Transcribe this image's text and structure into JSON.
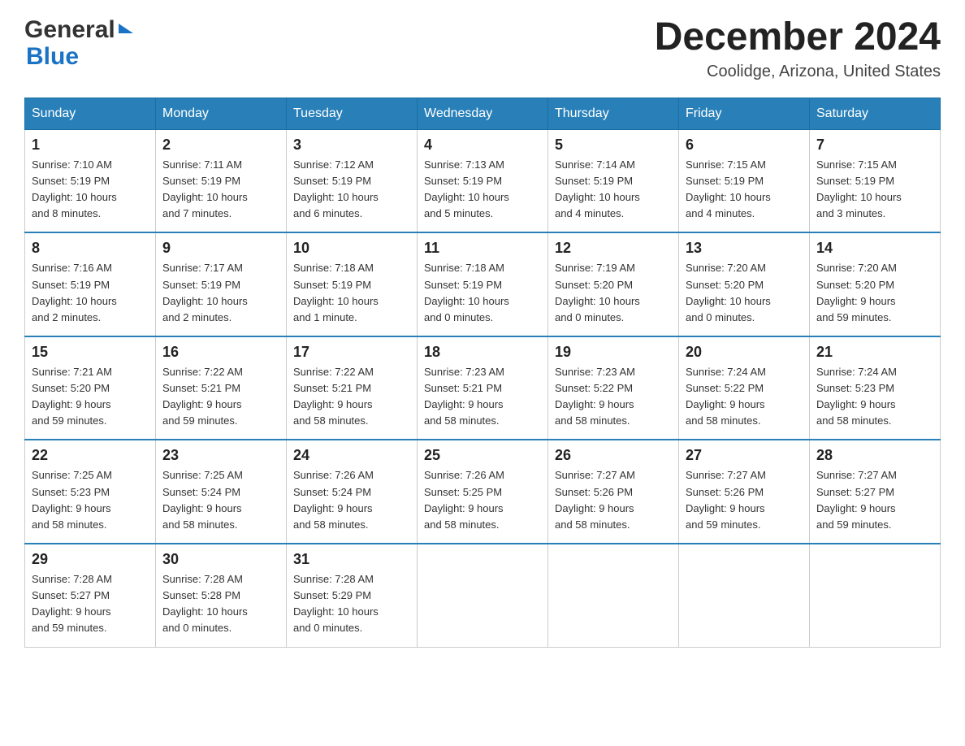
{
  "header": {
    "logo_general": "General",
    "logo_blue": "Blue",
    "month_title": "December 2024",
    "location": "Coolidge, Arizona, United States"
  },
  "days_of_week": [
    "Sunday",
    "Monday",
    "Tuesday",
    "Wednesday",
    "Thursday",
    "Friday",
    "Saturday"
  ],
  "weeks": [
    [
      {
        "day": "1",
        "sunrise": "7:10 AM",
        "sunset": "5:19 PM",
        "daylight": "10 hours and 8 minutes."
      },
      {
        "day": "2",
        "sunrise": "7:11 AM",
        "sunset": "5:19 PM",
        "daylight": "10 hours and 7 minutes."
      },
      {
        "day": "3",
        "sunrise": "7:12 AM",
        "sunset": "5:19 PM",
        "daylight": "10 hours and 6 minutes."
      },
      {
        "day": "4",
        "sunrise": "7:13 AM",
        "sunset": "5:19 PM",
        "daylight": "10 hours and 5 minutes."
      },
      {
        "day": "5",
        "sunrise": "7:14 AM",
        "sunset": "5:19 PM",
        "daylight": "10 hours and 4 minutes."
      },
      {
        "day": "6",
        "sunrise": "7:15 AM",
        "sunset": "5:19 PM",
        "daylight": "10 hours and 4 minutes."
      },
      {
        "day": "7",
        "sunrise": "7:15 AM",
        "sunset": "5:19 PM",
        "daylight": "10 hours and 3 minutes."
      }
    ],
    [
      {
        "day": "8",
        "sunrise": "7:16 AM",
        "sunset": "5:19 PM",
        "daylight": "10 hours and 2 minutes."
      },
      {
        "day": "9",
        "sunrise": "7:17 AM",
        "sunset": "5:19 PM",
        "daylight": "10 hours and 2 minutes."
      },
      {
        "day": "10",
        "sunrise": "7:18 AM",
        "sunset": "5:19 PM",
        "daylight": "10 hours and 1 minute."
      },
      {
        "day": "11",
        "sunrise": "7:18 AM",
        "sunset": "5:19 PM",
        "daylight": "10 hours and 0 minutes."
      },
      {
        "day": "12",
        "sunrise": "7:19 AM",
        "sunset": "5:20 PM",
        "daylight": "10 hours and 0 minutes."
      },
      {
        "day": "13",
        "sunrise": "7:20 AM",
        "sunset": "5:20 PM",
        "daylight": "10 hours and 0 minutes."
      },
      {
        "day": "14",
        "sunrise": "7:20 AM",
        "sunset": "5:20 PM",
        "daylight": "9 hours and 59 minutes."
      }
    ],
    [
      {
        "day": "15",
        "sunrise": "7:21 AM",
        "sunset": "5:20 PM",
        "daylight": "9 hours and 59 minutes."
      },
      {
        "day": "16",
        "sunrise": "7:22 AM",
        "sunset": "5:21 PM",
        "daylight": "9 hours and 59 minutes."
      },
      {
        "day": "17",
        "sunrise": "7:22 AM",
        "sunset": "5:21 PM",
        "daylight": "9 hours and 58 minutes."
      },
      {
        "day": "18",
        "sunrise": "7:23 AM",
        "sunset": "5:21 PM",
        "daylight": "9 hours and 58 minutes."
      },
      {
        "day": "19",
        "sunrise": "7:23 AM",
        "sunset": "5:22 PM",
        "daylight": "9 hours and 58 minutes."
      },
      {
        "day": "20",
        "sunrise": "7:24 AM",
        "sunset": "5:22 PM",
        "daylight": "9 hours and 58 minutes."
      },
      {
        "day": "21",
        "sunrise": "7:24 AM",
        "sunset": "5:23 PM",
        "daylight": "9 hours and 58 minutes."
      }
    ],
    [
      {
        "day": "22",
        "sunrise": "7:25 AM",
        "sunset": "5:23 PM",
        "daylight": "9 hours and 58 minutes."
      },
      {
        "day": "23",
        "sunrise": "7:25 AM",
        "sunset": "5:24 PM",
        "daylight": "9 hours and 58 minutes."
      },
      {
        "day": "24",
        "sunrise": "7:26 AM",
        "sunset": "5:24 PM",
        "daylight": "9 hours and 58 minutes."
      },
      {
        "day": "25",
        "sunrise": "7:26 AM",
        "sunset": "5:25 PM",
        "daylight": "9 hours and 58 minutes."
      },
      {
        "day": "26",
        "sunrise": "7:27 AM",
        "sunset": "5:26 PM",
        "daylight": "9 hours and 58 minutes."
      },
      {
        "day": "27",
        "sunrise": "7:27 AM",
        "sunset": "5:26 PM",
        "daylight": "9 hours and 59 minutes."
      },
      {
        "day": "28",
        "sunrise": "7:27 AM",
        "sunset": "5:27 PM",
        "daylight": "9 hours and 59 minutes."
      }
    ],
    [
      {
        "day": "29",
        "sunrise": "7:28 AM",
        "sunset": "5:27 PM",
        "daylight": "9 hours and 59 minutes."
      },
      {
        "day": "30",
        "sunrise": "7:28 AM",
        "sunset": "5:28 PM",
        "daylight": "10 hours and 0 minutes."
      },
      {
        "day": "31",
        "sunrise": "7:28 AM",
        "sunset": "5:29 PM",
        "daylight": "10 hours and 0 minutes."
      },
      null,
      null,
      null,
      null
    ]
  ],
  "labels": {
    "sunrise": "Sunrise:",
    "sunset": "Sunset:",
    "daylight": "Daylight:"
  }
}
